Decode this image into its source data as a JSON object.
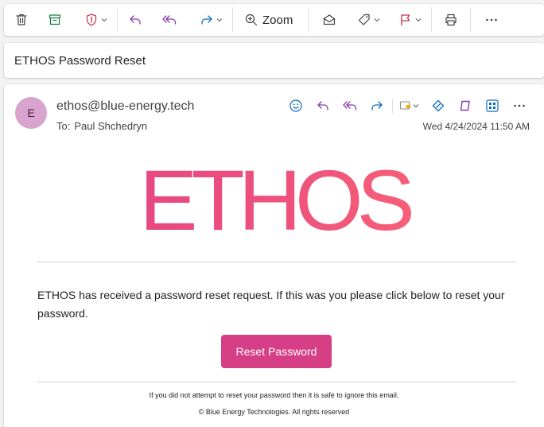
{
  "toolbar": {
    "zoom_label": "Zoom"
  },
  "message": {
    "subject": "ETHOS Password Reset",
    "avatar_initial": "E",
    "sender": "ethos@blue-energy.tech",
    "to_label": "To:",
    "to_name": "Paul Shchedryn",
    "date": "Wed 4/24/2024 11:50 AM"
  },
  "email_body": {
    "logo_text": "ETHOS",
    "paragraph": "ETHOS has received a password reset request. If this was you please click below to reset your password.",
    "reset_button_label": "Reset Password",
    "footer_notice": "If you did not attempt to reset your password then it is safe to ignore this email.",
    "copyright": "© Blue Energy Technologies. All rights reserved"
  },
  "colors": {
    "brand_pink": "#d63f86",
    "logo_gradient_start": "#de3f86",
    "logo_gradient_end": "#ff6a74",
    "avatar_bg": "#d8a3cc",
    "reply_icon": "#8a3aa8",
    "accent_blue": "#0f6cbd"
  }
}
